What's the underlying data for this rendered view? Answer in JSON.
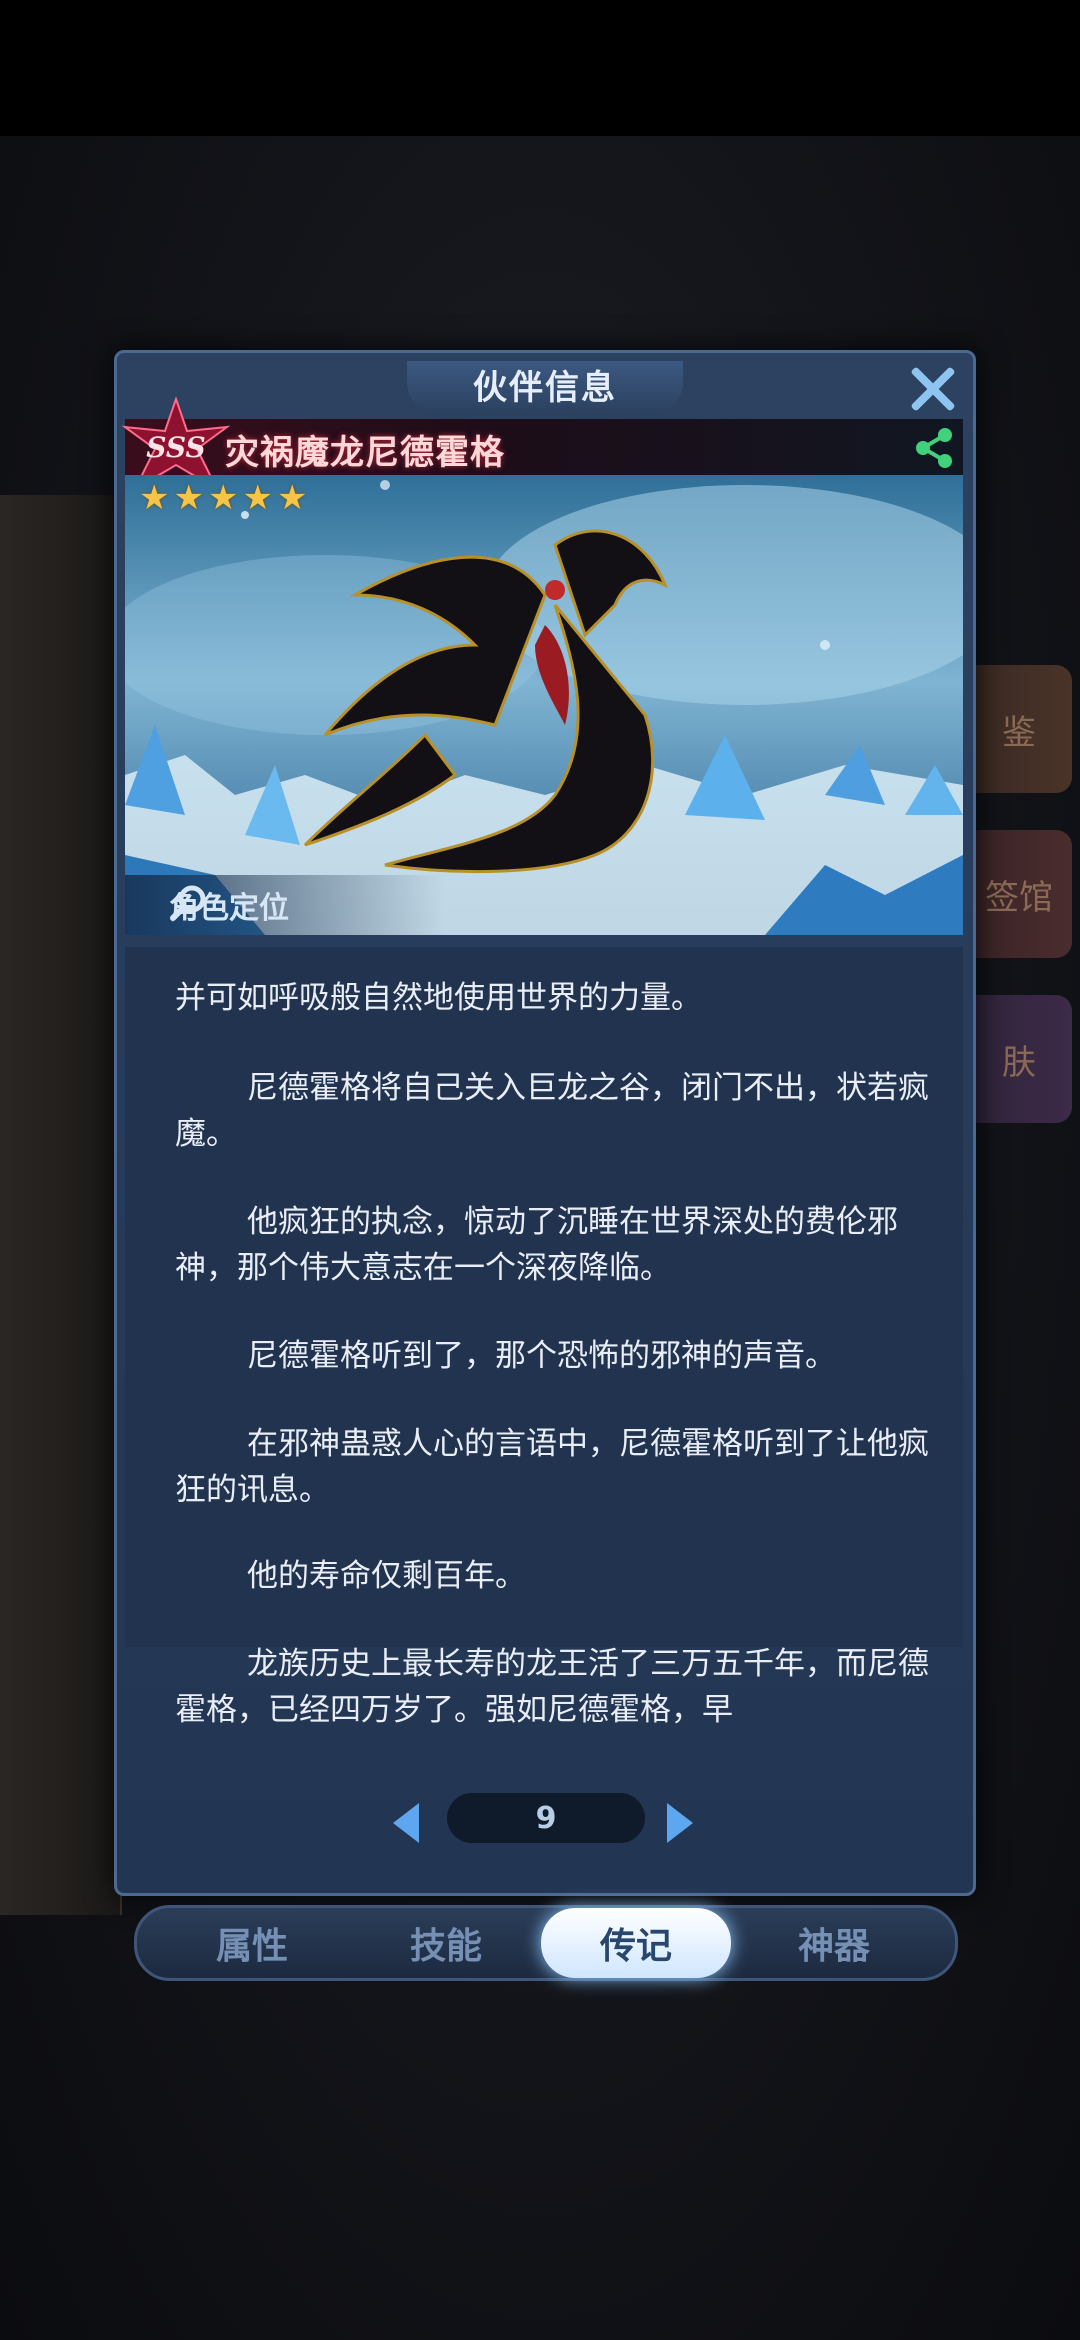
{
  "panel": {
    "title": "伙伴信息"
  },
  "hero": {
    "rank": "SSS",
    "name": "灾祸魔龙尼德霍格",
    "stars": 5
  },
  "art": {
    "locate_label": "角色定位"
  },
  "side_tabs": [
    "鉴",
    "签馆",
    "肤"
  ],
  "biography": {
    "paragraphs": [
      "并可如呼吸般自然地使用世界的力量。",
      "尼德霍格将自己关入巨龙之谷，闭门不出，状若疯魔。",
      "他疯狂的执念，惊动了沉睡在世界深处的费伦邪神，那个伟大意志在一个深夜降临。",
      "尼德霍格听到了，那个恐怖的邪神的声音。",
      "在邪神蛊惑人心的言语中，尼德霍格听到了让他疯狂的讯息。",
      "他的寿命仅剩百年。",
      "龙族历史上最长寿的龙王活了三万五千年，而尼德霍格，已经四万岁了。强如尼德霍格，早"
    ]
  },
  "pager": {
    "page": "9"
  },
  "tabs": [
    "属性",
    "技能",
    "传记",
    "神器"
  ],
  "active_tab": "传记",
  "colors": {
    "accent": "#5ea6f0",
    "panel": "#223350",
    "star": "#f6c447",
    "share": "#3fd27a"
  }
}
